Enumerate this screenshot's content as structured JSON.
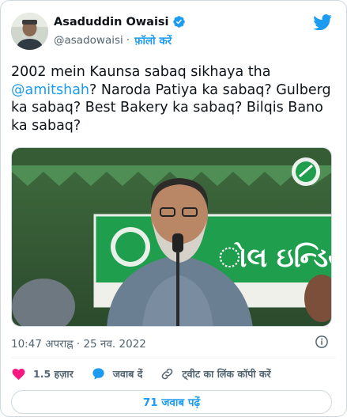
{
  "author": {
    "name": "Asaduddin Owaisi",
    "handle": "@asadowaisi",
    "separator": "·",
    "follow_label": "फ़ॉलो करें"
  },
  "tweet": {
    "text_before": "2002 mein Kaunsa sabaq sikhaya tha ",
    "mention": "@amitshah",
    "text_after": "? Naroda Patiya ka sabaq? Gulberg ka sabaq? Best Bakery ka sabaq? Bilqis Bano ka sabaq?"
  },
  "media": {
    "banner_text": "ોલ ઇન્ડિયા"
  },
  "meta": {
    "timestamp": "10:47 अपराह्न · 25 नव. 2022"
  },
  "actions": {
    "likes": "1.5 हज़ार",
    "reply_label": "जवाब दें",
    "copy_link_label": "ट्वीट का लिंक कॉपी करें"
  },
  "replies_button": "71 जवाब पढ़ें",
  "colors": {
    "accent": "#1d9bf0",
    "like": "#f91880",
    "muted": "#536471"
  }
}
